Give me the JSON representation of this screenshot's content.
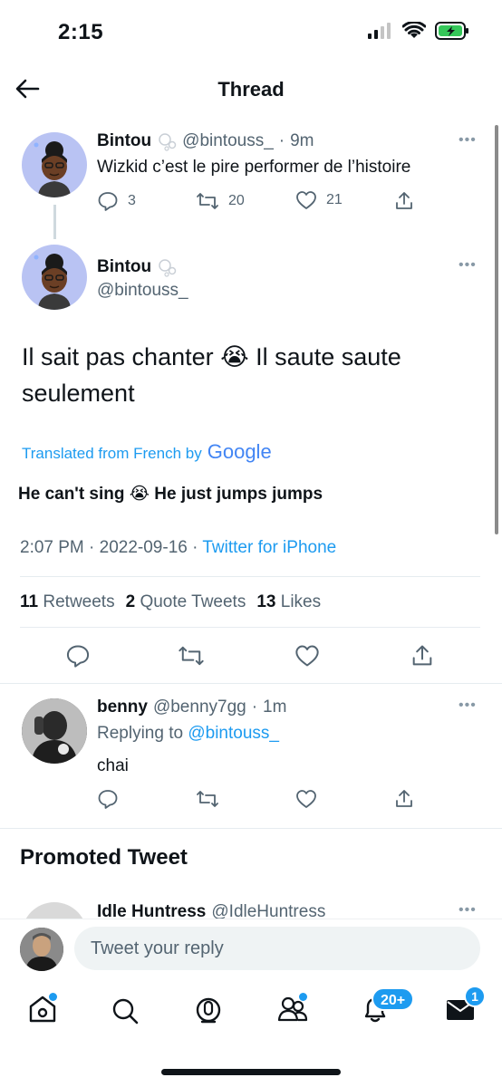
{
  "status": {
    "time": "2:15"
  },
  "header": {
    "title": "Thread"
  },
  "tweet1": {
    "name": "Bintou",
    "handle": "@bintouss_",
    "sep": "·",
    "time": "9m",
    "text": "Wizkid c’est le pire performer de l’histoire",
    "replies": "3",
    "retweets": "20",
    "likes": "21"
  },
  "main_tweet": {
    "name": "Bintou",
    "handle": "@bintouss_",
    "text": "Il sait pas chanter 😭 Il saute saute seulement",
    "translated_label": "Translated from French by",
    "google": "Google",
    "translation": "He can't sing 😭 He just jumps jumps",
    "meta_time": "2:07 PM · 2022-09-16 · ",
    "meta_source": "Twitter for iPhone",
    "retweets_count": "11",
    "retweets_label": "Retweets",
    "quote_count": "2",
    "quote_label": "Quote Tweets",
    "likes_count": "13",
    "likes_label": "Likes"
  },
  "reply": {
    "name": "benny",
    "handle": "@benny7gg",
    "sep": "·",
    "time": "1m",
    "replying_to_label": "Replying to",
    "replying_to": "@bintouss_",
    "text": "chai"
  },
  "promoted": {
    "heading": "Promoted Tweet",
    "name": "Idle Huntress",
    "handle": "@IdleHuntress"
  },
  "composer": {
    "placeholder": "Tweet your reply"
  },
  "tabs": {
    "notifications_badge": "20+",
    "messages_badge": "1"
  },
  "colors": {
    "accent": "#1d9bf0",
    "text": "#0f1419",
    "muted": "#536471",
    "divider": "#e6ecf0",
    "battery": "#34c759"
  }
}
